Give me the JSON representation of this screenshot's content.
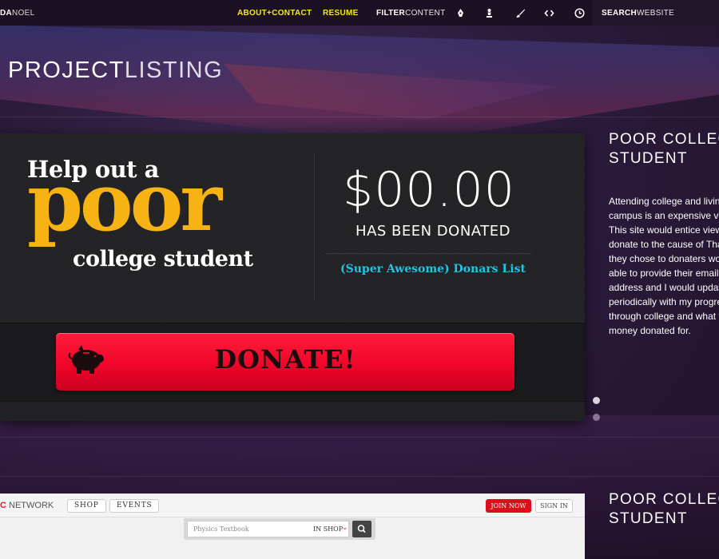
{
  "topbar": {
    "brand_prefix": "DA",
    "brand_suffix": "NOEL",
    "nav": [
      {
        "label": "ABOUT+CONTACT"
      },
      {
        "label": "RESUME"
      }
    ],
    "filter_bold": "FILTER",
    "filter_light": "CONTENT",
    "filter_icons": [
      "pen-icon",
      "chess-pawn-icon",
      "brush-icon",
      "code-icon",
      "clock-icon"
    ],
    "search_bold": "SEARCH",
    "search_light": "WEBSITE"
  },
  "page": {
    "title_bold": "PROJECT",
    "title_light": "LISTING"
  },
  "project1": {
    "headline_top": "Help out a",
    "headline_big": "poor",
    "headline_bottom": "college student",
    "amount": "$00.00",
    "amount_caption": "HAS BEEN DONATED",
    "donars_link": "(Super Awesome) Donars List",
    "donate_label": "DONATE!",
    "side_title_line1": "POOR COLLEGE",
    "side_title_line2": "STUDENT",
    "side_description": "Attending college and living on campus is an expensive venture. This site would entice viewers to donate to the cause of That, if they chose to donaters would be able to provide their email address and I would update them periodically with my progress through college and what the money donated for."
  },
  "project2": {
    "brand_c": "C",
    "brand_rest": "NETWORK",
    "tabs": [
      "SHOP",
      "EVENTS"
    ],
    "join": "JOIN NOW",
    "signin": "SIGN IN",
    "search_placeholder": "Physics Textbook",
    "search_scope": "IN SHOP",
    "side_title_line1": "POOR COLLEGE",
    "side_title_line2": "STUDENT"
  },
  "colors": {
    "accent_yellow": "#f3e91c",
    "poor_yellow": "#f7b314",
    "donate_red": "#f0062a",
    "link_cyan": "#1fc4e6",
    "topbar": "#1b1122"
  }
}
